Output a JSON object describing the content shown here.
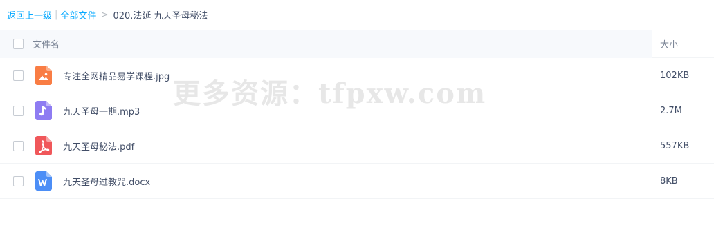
{
  "breadcrumb": {
    "back_label": "返回上一级",
    "all_files_label": "全部文件",
    "separator": "|",
    "arrow": ">",
    "current": "020.法延 九天圣母秘法"
  },
  "table": {
    "header_name": "文件名",
    "header_size": "大小"
  },
  "files": [
    {
      "name": "专注全网精品易学课程.jpg",
      "size": "102KB",
      "icon": "image-icon",
      "color": "#f97d44"
    },
    {
      "name": "九天圣母一期.mp3",
      "size": "2.7M",
      "icon": "music-icon",
      "color": "#8e7cf2"
    },
    {
      "name": "九天圣母秘法.pdf",
      "size": "557KB",
      "icon": "pdf-icon",
      "color": "#f0575a"
    },
    {
      "name": "九天圣母过教咒.docx",
      "size": "8KB",
      "icon": "word-icon",
      "color": "#4c8ef6"
    }
  ],
  "watermark": "更多资源：tfpxw.com"
}
